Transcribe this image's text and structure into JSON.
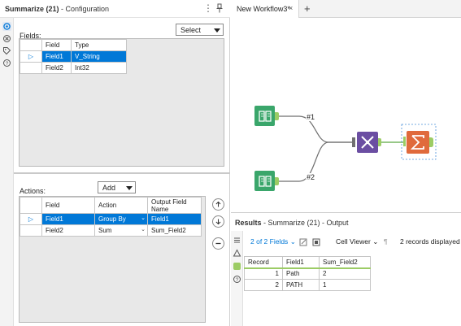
{
  "config": {
    "title_bold": "Summarize (21)",
    "title_rest": " - Configuration",
    "fields_label": "Fields:",
    "select_button": "Select",
    "fields_table": {
      "headers": [
        "Field",
        "Type"
      ],
      "rows": [
        {
          "field": "Field1",
          "type": "V_String",
          "selected": true
        },
        {
          "field": "Field2",
          "type": "Int32",
          "selected": false
        }
      ]
    },
    "actions_label": "Actions:",
    "add_button": "Add",
    "actions_table": {
      "headers": [
        "Field",
        "Action",
        "Output Field Name"
      ],
      "header_output_line1": "Output Field",
      "header_output_line2": "Name",
      "rows": [
        {
          "field": "Field1",
          "action": "Group By",
          "output": "Field1",
          "selected": true
        },
        {
          "field": "Field2",
          "action": "Sum",
          "output": "Sum_Field2",
          "selected": false
        }
      ]
    },
    "rail_icons": [
      "gear-icon",
      "x-circle-icon",
      "tag-icon",
      "help-icon"
    ]
  },
  "workflow": {
    "tab_title": "New Workflow3*",
    "tab_close": "×",
    "tab_add": "+",
    "connections": [
      {
        "label": "#1"
      },
      {
        "label": "#2"
      }
    ],
    "tools": [
      "input-data-1",
      "input-data-2",
      "join-union-tool",
      "summarize-tool"
    ]
  },
  "results": {
    "title_bold": "Results",
    "title_rest": " - Summarize (21) - Output",
    "fields_dropdown": "2 of 2 Fields",
    "cell_viewer": "Cell Viewer",
    "records_info": "2 records displayed",
    "table": {
      "headers": [
        "Record",
        "Field1",
        "Sum_Field2"
      ],
      "rows": [
        {
          "record": "1",
          "field1": "Path",
          "sum": "2"
        },
        {
          "record": "2",
          "field1": "PATH",
          "sum": "1"
        }
      ]
    }
  },
  "colors": {
    "accent_blue": "#0078d7",
    "input_tool_green": "#3aa66b",
    "join_tool_purple": "#6b4ea2",
    "summarize_tool_orange": "#e06a3c"
  }
}
